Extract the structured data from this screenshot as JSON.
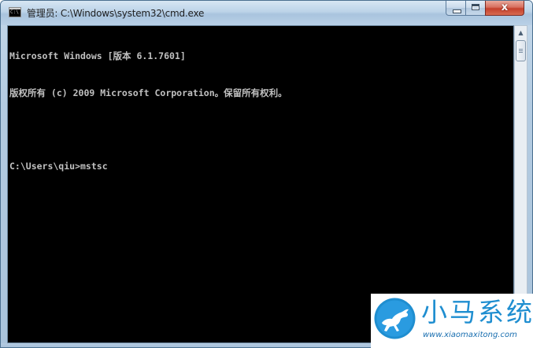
{
  "window": {
    "title": "管理员: C:\\Windows\\system32\\cmd.exe",
    "icon": "cmd-icon",
    "icon_text": "C:\\",
    "controls": {
      "minimize": "minimize-icon",
      "maximize": "maximize-icon",
      "close": "close-icon",
      "close_glyph": "x"
    }
  },
  "console": {
    "background": "#000000",
    "foreground": "#c0c0c0",
    "lines": [
      "Microsoft Windows [版本 6.1.7601]",
      "版权所有 (c) 2009 Microsoft Corporation。保留所有权利。",
      "",
      "C:\\Users\\qiu>mstsc"
    ]
  },
  "scrollbar": {
    "up_arrow": "scroll-up-arrow-icon"
  },
  "watermark": {
    "title": "小马系统",
    "url": "www.xiaomaxitong.com",
    "logo": "horse-logo-icon",
    "accent": "#1f8ed0"
  }
}
